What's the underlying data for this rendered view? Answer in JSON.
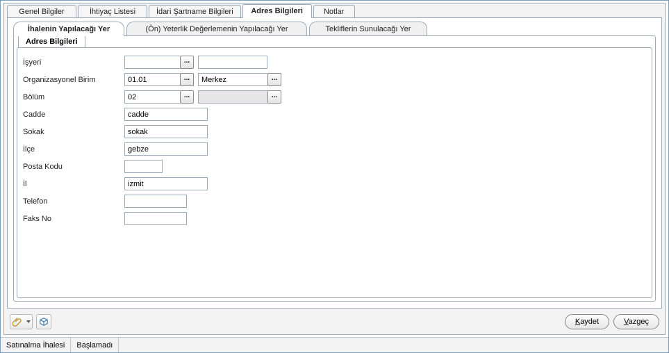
{
  "topTabs": {
    "genel": "Genel Bilgiler",
    "ihtiyac": "İhtiyaç Listesi",
    "idari": "İdari Şartname Bilgileri",
    "adres": "Adres Bilgileri",
    "notlar": "Notlar"
  },
  "subTabs": {
    "ihale": "İhalenin Yapılacağı Yer",
    "yeterlik": "(Ön) Yeterlik Değerlemenin Yapılacağı Yer",
    "teklif": "Tekliflerin Sunulacağı Yer"
  },
  "fieldset": {
    "title": "Adres Bilgileri",
    "labels": {
      "isyeri": "İşyeri",
      "orgBirim": "Organizasyonel Birim",
      "bolum": "Bölüm",
      "cadde": "Cadde",
      "sokak": "Sokak",
      "ilce": "İlçe",
      "postaKodu": "Posta Kodu",
      "il": "İl",
      "telefon": "Telefon",
      "faksNo": "Faks No"
    },
    "values": {
      "isyeriCode": "",
      "isyeriName": "",
      "orgBirimCode": "01.01",
      "orgBirimName": "Merkez",
      "bolumCode": "02",
      "bolumName": "",
      "cadde": "cadde",
      "sokak": "sokak",
      "ilce": "gebze",
      "postaKodu": "",
      "il": "izmit",
      "telefon": "",
      "faksNo": ""
    }
  },
  "buttons": {
    "kaydet": "Kaydet",
    "vazgec": "Vazgeç"
  },
  "status": {
    "left": "Satınalma İhalesi",
    "right": "Başlamadı"
  }
}
